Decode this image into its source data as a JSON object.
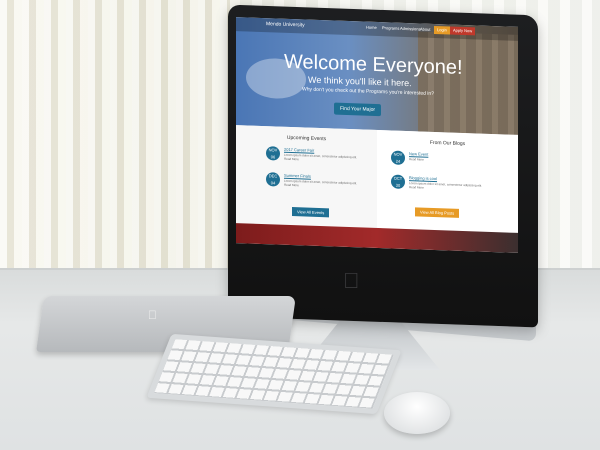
{
  "screen": {
    "brand": "Mendo University",
    "nav": [
      "Home",
      "Programs",
      "Admissions",
      "About",
      "Login",
      "Apply Now"
    ],
    "hero_title": "Welcome Everyone!",
    "hero_subtitle": "We think you'll like it here.",
    "hero_text": "Why don't you check out the Programs you're interested in?",
    "hero_button": "Find Your Major",
    "events_heading": "Upcoming Events",
    "events": [
      {
        "month": "NOV",
        "day": "06",
        "title": "2017 Career Fair",
        "text": "Lorem ipsum dolor sit amet, consectetur adipiscing elit. Read More"
      },
      {
        "month": "DEC",
        "day": "04",
        "title": "Summer Finals",
        "text": "Lorem ipsum dolor sit amet, consectetur adipiscing elit. Read More"
      }
    ],
    "events_button": "View All Events",
    "blogs_heading": "From Our Blogs",
    "blogs": [
      {
        "month": "NOV",
        "day": "24",
        "title": "New Event",
        "text": "Read More"
      },
      {
        "month": "OCT",
        "day": "30",
        "title": "Blogging is cool",
        "text": "Lorem ipsum dolor sit amet, consectetur adipiscing elit. Read More"
      }
    ],
    "blogs_button": "View All Blog Posts"
  }
}
